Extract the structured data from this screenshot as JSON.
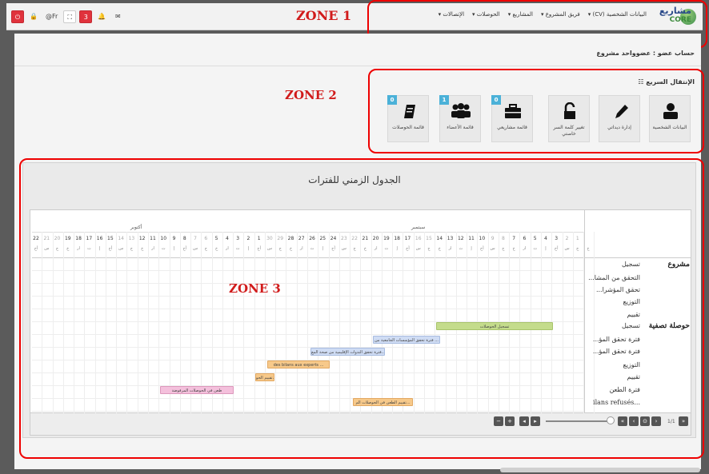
{
  "zones": {
    "z1": "ZONE 1",
    "z2": "ZONE 2",
    "z3": "ZONE 3"
  },
  "topbar": {
    "buttons": [
      {
        "label": "⏻",
        "name": "power-button"
      },
      {
        "label": "🔒",
        "name": "lock-button"
      },
      {
        "label": "@Fr",
        "name": "language-button"
      },
      {
        "label": "⛶",
        "name": "fullscreen-button"
      },
      {
        "label": "3",
        "name": "notifications-count-button"
      },
      {
        "label": "🔔",
        "name": "bell-button"
      },
      {
        "label": "✉",
        "name": "mail-button"
      }
    ],
    "nav": [
      {
        "label": "البيانات الشخصية (CV) ▾",
        "name": "nav-personal-data"
      },
      {
        "label": "فريق المشروع ▾",
        "name": "nav-project-team"
      },
      {
        "label": "المشاريع ▾",
        "name": "nav-projects"
      },
      {
        "label": "الحوصلات ▾",
        "name": "nav-summaries"
      },
      {
        "label": "الإتصالات ▾",
        "name": "nav-contacts"
      }
    ],
    "logo": {
      "line1": "مشاريع",
      "line2": "CORE"
    }
  },
  "account_line": "حساب عضو : عضوواحد مشروع",
  "quick": {
    "title": "الإنتقال السريع",
    "tiles": [
      {
        "label": "البيانات الشخصية",
        "badge": ""
      },
      {
        "label": "إدارة ديداتي",
        "badge": ""
      },
      {
        "label": "تغيير كلمة السر خاصتي",
        "badge": ""
      },
      {
        "label": "قائمة مشاريعي",
        "badge": "0"
      },
      {
        "label": "قائمة الأعضاء",
        "badge": "1"
      },
      {
        "label": "قائمة الحوصلات",
        "badge": "0"
      }
    ]
  },
  "timeline": {
    "title": "الجدول الزمني للفترات",
    "months": [
      "أكتوبر",
      "سبتمبر"
    ],
    "day_numbers": [
      "22",
      "21",
      "20",
      "19",
      "18",
      "17",
      "16",
      "15",
      "14",
      "13",
      "12",
      "11",
      "10",
      "9",
      "8",
      "7",
      "6",
      "5",
      "4",
      "3",
      "2",
      "1",
      "30",
      "29",
      "28",
      "27",
      "26",
      "25",
      "24",
      "23",
      "22",
      "21",
      "20",
      "19",
      "18",
      "17",
      "16",
      "15",
      "14",
      "13",
      "12",
      "11",
      "10",
      "9",
      "8",
      "7",
      "6",
      "5",
      "4",
      "3",
      "2",
      "1",
      ""
    ],
    "day_names": [
      "أح",
      "س",
      "ج",
      "خ",
      "ار",
      "ث",
      "إ",
      "أح",
      "س",
      "ج",
      "خ",
      "ار",
      "ث",
      "إ",
      "أح",
      "س",
      "ج",
      "خ",
      "ار",
      "ث",
      "إ",
      "أح",
      "س",
      "ج",
      "خ",
      "ار",
      "ث",
      "إ",
      "أح",
      "س",
      "ج",
      "خ",
      "ار",
      "ث",
      "إ",
      "أح",
      "س",
      "ج",
      "خ",
      "ار",
      "ث",
      "إ",
      "أح",
      "س",
      "ج",
      "خ",
      "ار",
      "ث",
      "إ",
      "أح",
      "س",
      "ج",
      "خ"
    ],
    "groups": [
      "مشروع",
      "حوصلة تصفية"
    ],
    "tasks": [
      "تسجيل",
      "التحقق من المشا...",
      "تحقق المؤشرا...",
      "التوزيع",
      "تقييم",
      "تسجيل",
      "فترة تحقق المؤ...",
      "فترة تحقق المؤ...",
      "التوزيع",
      "تقييم",
      "فترة الطعن",
      "...ilans refusés"
    ],
    "bars": [
      {
        "label": "تسجيل الحوصلات",
        "color": "green"
      },
      {
        "label": "فترة تحقق المؤسسات الجامعية من ...",
        "color": "blue"
      },
      {
        "label": "فترة تحقق الندوات الإقليمية من صحة المع...",
        "color": "blue"
      },
      {
        "label": "des bilans aux experts ...",
        "color": "orange"
      },
      {
        "label": "تقييم الحو...",
        "color": "orange"
      },
      {
        "label": "طعن في الحوصلات المرفوضة",
        "color": "pink"
      },
      {
        "label": "تقييم الطعن في الحوصلات الم...",
        "color": "orange"
      }
    ],
    "controls": {
      "pager": "1/1"
    }
  }
}
